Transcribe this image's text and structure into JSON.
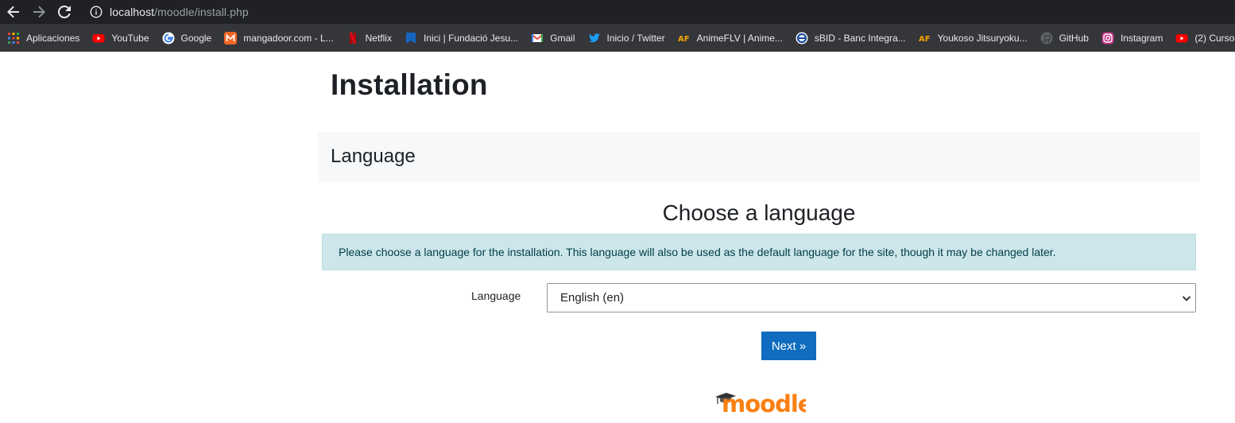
{
  "browser": {
    "url_host": "localhost",
    "url_path": "/moodle/install.php",
    "bookmarks": [
      {
        "label": "Aplicaciones",
        "icon": "apps-grid-icon"
      },
      {
        "label": "YouTube",
        "icon": "youtube-icon"
      },
      {
        "label": "Google",
        "icon": "google-icon"
      },
      {
        "label": "mangadoor.com - L...",
        "icon": "mangadoor-icon"
      },
      {
        "label": "Netflix",
        "icon": "netflix-icon"
      },
      {
        "label": "Inici | Fundació Jesu...",
        "icon": "bookmark-blue-icon"
      },
      {
        "label": "Gmail",
        "icon": "gmail-icon"
      },
      {
        "label": "Inicio / Twitter",
        "icon": "twitter-icon"
      },
      {
        "label": "AnimeFLV | Anime...",
        "icon": "animeflv-icon"
      },
      {
        "label": "sBID - Banc Integra...",
        "icon": "sbid-icon"
      },
      {
        "label": "Youkoso Jitsuryoku...",
        "icon": "animeflv-icon"
      },
      {
        "label": "GitHub",
        "icon": "github-icon"
      },
      {
        "label": "Instagram",
        "icon": "instagram-icon"
      },
      {
        "label": "(2) Curso",
        "icon": "youtube-icon"
      }
    ]
  },
  "page": {
    "title": "Installation",
    "section_title": "Language",
    "heading": "Choose a language",
    "info": "Please choose a language for the installation. This language will also be used as the default language for the site, though it may be changed later.",
    "language_label": "Language",
    "language_selected": "English (en)",
    "next_label": "Next »",
    "logo_text": "moodle"
  },
  "colors": {
    "primary_button": "#0f6cbf",
    "info_background": "#cce6ea",
    "moodle_orange": "#f98012",
    "logo_cap": "#333333"
  }
}
